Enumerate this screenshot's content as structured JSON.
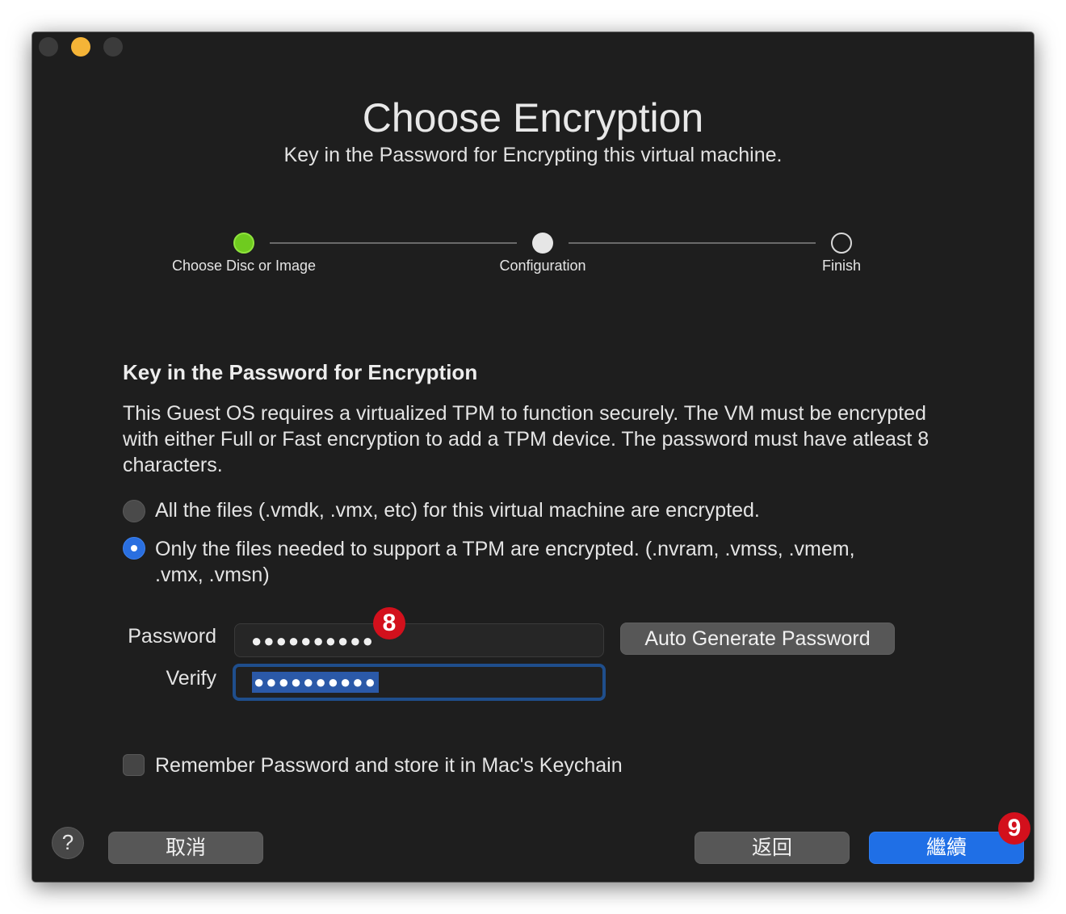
{
  "window": {
    "title": "Choose Encryption",
    "subtitle": "Key in the Password for Encrypting this virtual machine."
  },
  "steps": [
    {
      "label": "Choose Disc or Image",
      "state": "completed"
    },
    {
      "label": "Configuration",
      "state": "current"
    },
    {
      "label": "Finish",
      "state": "pending"
    }
  ],
  "section": {
    "heading": "Key in the Password for Encryption",
    "description": "This Guest OS requires a virtualized TPM to function securely. The VM must be encrypted with either Full or Fast encryption to add a TPM device. The password must have atleast 8 characters."
  },
  "encryption_options": [
    {
      "label": "All the files (.vmdk, .vmx, etc) for this virtual machine are encrypted.",
      "selected": false
    },
    {
      "label": "Only the files needed to support a TPM are encrypted. (.nvram, .vmss, .vmem, .vmx, .vmsn)",
      "selected": true
    }
  ],
  "password": {
    "label": "Password",
    "value_masked": "●●●●●●●●●●"
  },
  "verify": {
    "label": "Verify",
    "value_masked": "●●●●●●●●●●"
  },
  "auto_generate_label": "Auto Generate Password",
  "keychain": {
    "label": "Remember Password and store it in Mac's Keychain",
    "checked": false
  },
  "footer": {
    "help_label": "?",
    "cancel_label": "取消",
    "back_label": "返回",
    "continue_label": "繼續"
  },
  "annotations": {
    "badge_8": "8",
    "badge_9": "9"
  },
  "colors": {
    "accent": "#1f6fe6",
    "step_done": "#6fcb1f",
    "badge": "#d3101c",
    "window_bg": "#1e1e1e"
  }
}
